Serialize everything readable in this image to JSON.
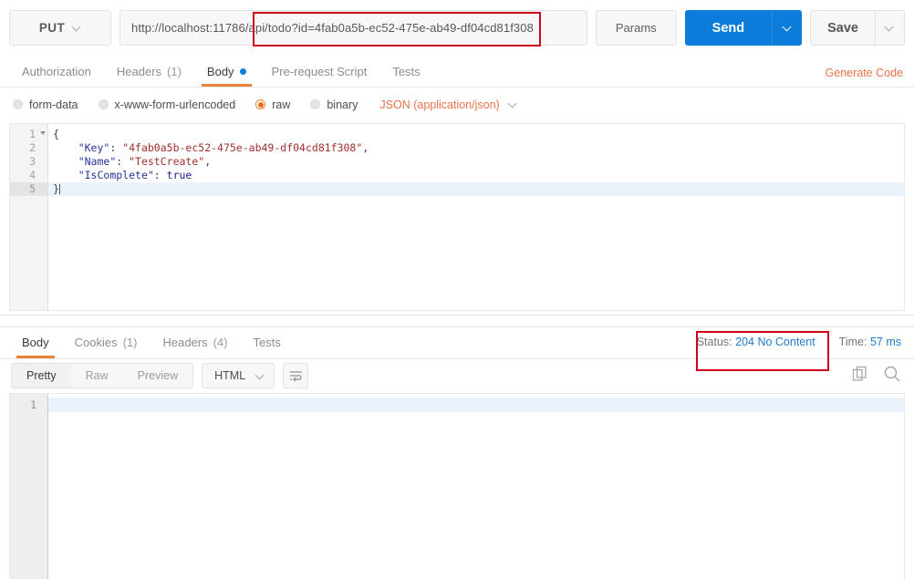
{
  "request": {
    "method": "PUT",
    "method_caret_icon": "chevron-down-icon",
    "url": "http://localhost:11786/api/todo?id=4fab0a5b-ec52-475e-ab49-df04cd81f308",
    "url_placeholder": "Enter request URL",
    "params_label": "Params",
    "send_label": "Send",
    "save_label": "Save",
    "tabs": [
      {
        "label": "Authorization",
        "active": false,
        "count": ""
      },
      {
        "label": "Headers",
        "active": false,
        "count": "(1)"
      },
      {
        "label": "Body",
        "active": true,
        "count": "",
        "dot": true
      },
      {
        "label": "Pre-request Script",
        "active": false,
        "count": ""
      },
      {
        "label": "Tests",
        "active": false,
        "count": ""
      }
    ],
    "generate_code_label": "Generate Code",
    "body_types": [
      {
        "label": "form-data",
        "selected": false
      },
      {
        "label": "x-www-form-urlencoded",
        "selected": false
      },
      {
        "label": "raw",
        "selected": true
      },
      {
        "label": "binary",
        "selected": false
      }
    ],
    "content_type_label": "JSON (application/json)",
    "editor": {
      "line_numbers": [
        "1",
        "2",
        "3",
        "4",
        "5"
      ],
      "active_line": 5,
      "lines": [
        {
          "n": "1",
          "text": "{"
        },
        {
          "n": "2",
          "text": "    \"Key\": \"4fab0a5b-ec52-475e-ab49-df04cd81f308\","
        },
        {
          "n": "3",
          "text": "    \"Name\": \"TestCreate\","
        },
        {
          "n": "4",
          "text": "    \"IsComplete\": true"
        },
        {
          "n": "5",
          "text": "}"
        }
      ],
      "l1_brace": "{",
      "l2_key": "\"Key\"",
      "l2_colon": ": ",
      "l2_val": "\"4fab0a5b-ec52-475e-ab49-df04cd81f308\"",
      "l2_comma": ",",
      "l3_key": "\"Name\"",
      "l3_colon": ": ",
      "l3_val": "\"TestCreate\"",
      "l3_comma": ",",
      "l4_key": "\"IsComplete\"",
      "l4_colon": ": ",
      "l4_val": "true",
      "l5_brace": "}"
    }
  },
  "response": {
    "tabs": [
      {
        "label": "Body",
        "active": true,
        "count": ""
      },
      {
        "label": "Cookies",
        "active": false,
        "count": "(1)"
      },
      {
        "label": "Headers",
        "active": false,
        "count": "(4)"
      },
      {
        "label": "Tests",
        "active": false,
        "count": ""
      }
    ],
    "status_label": "Status:",
    "status_value": "204 No Content",
    "time_label": "Time:",
    "time_value": "57 ms",
    "view_modes": [
      {
        "label": "Pretty",
        "active": true
      },
      {
        "label": "Raw",
        "active": false
      },
      {
        "label": "Preview",
        "active": false
      }
    ],
    "format_label": "HTML",
    "wrap_icon": "word-wrap-icon",
    "copy_icon": "copy-icon",
    "search_icon": "search-icon",
    "body_line_numbers": [
      "1"
    ],
    "body_text": ""
  },
  "colors": {
    "accent_orange": "#e8833a",
    "send_blue": "#0d7ddb",
    "status_blue": "#1e7bcb",
    "annotation_red": "#d0021b",
    "json_key": "#283593",
    "json_string": "#a0302c"
  },
  "annotations": [
    {
      "name": "url-highlight-box"
    },
    {
      "name": "status-highlight-box"
    }
  ]
}
